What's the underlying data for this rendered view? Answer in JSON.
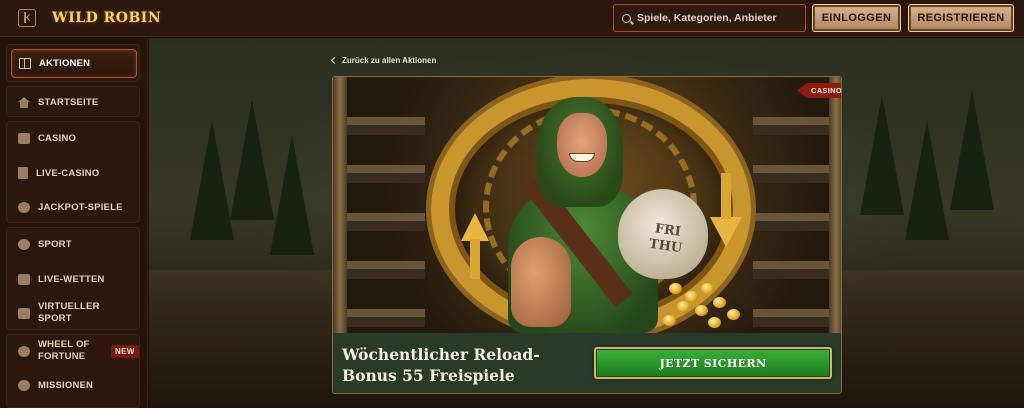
{
  "header": {
    "logo": "WILD ROBIN",
    "search_placeholder": "Spiele, Kategorien, Anbieter",
    "login_label": "EINLOGGEN",
    "register_label": "REGISTRIEREN"
  },
  "sidebar": {
    "items": [
      {
        "label": "AKTIONEN",
        "icon": "gift-icon"
      },
      {
        "label": "STARTSEITE",
        "icon": "home-icon"
      },
      {
        "label": "CASINO",
        "icon": "casino-icon"
      },
      {
        "label": "LIVE-CASINO",
        "icon": "cards-icon"
      },
      {
        "label": "JACKPOT-SPIELE",
        "icon": "puzzle-icon"
      },
      {
        "label": "SPORT",
        "icon": "football-icon"
      },
      {
        "label": "LIVE-WETTEN",
        "icon": "live-icon"
      },
      {
        "label": "VIRTUELLER SPORT",
        "icon": "virtual-sport-icon"
      },
      {
        "label": "WHEEL OF FORTUNE",
        "icon": "wheel-icon",
        "badge": "NEW"
      },
      {
        "label": "MISSIONEN",
        "icon": "target-icon"
      }
    ]
  },
  "main": {
    "back_link": "Zurück zu allen Aktionen",
    "promo": {
      "tag": "CASINO",
      "bag_text": "FRI THU",
      "title": "Wöchentlicher Reload-Bonus 55 Freispiele",
      "cta_label": "JETZT SICHERN"
    }
  },
  "colors": {
    "accent_border": "#b4552c",
    "cta_green": "#2a9a2c",
    "gold": "#d9b45a",
    "badge_red": "#7a1711"
  }
}
